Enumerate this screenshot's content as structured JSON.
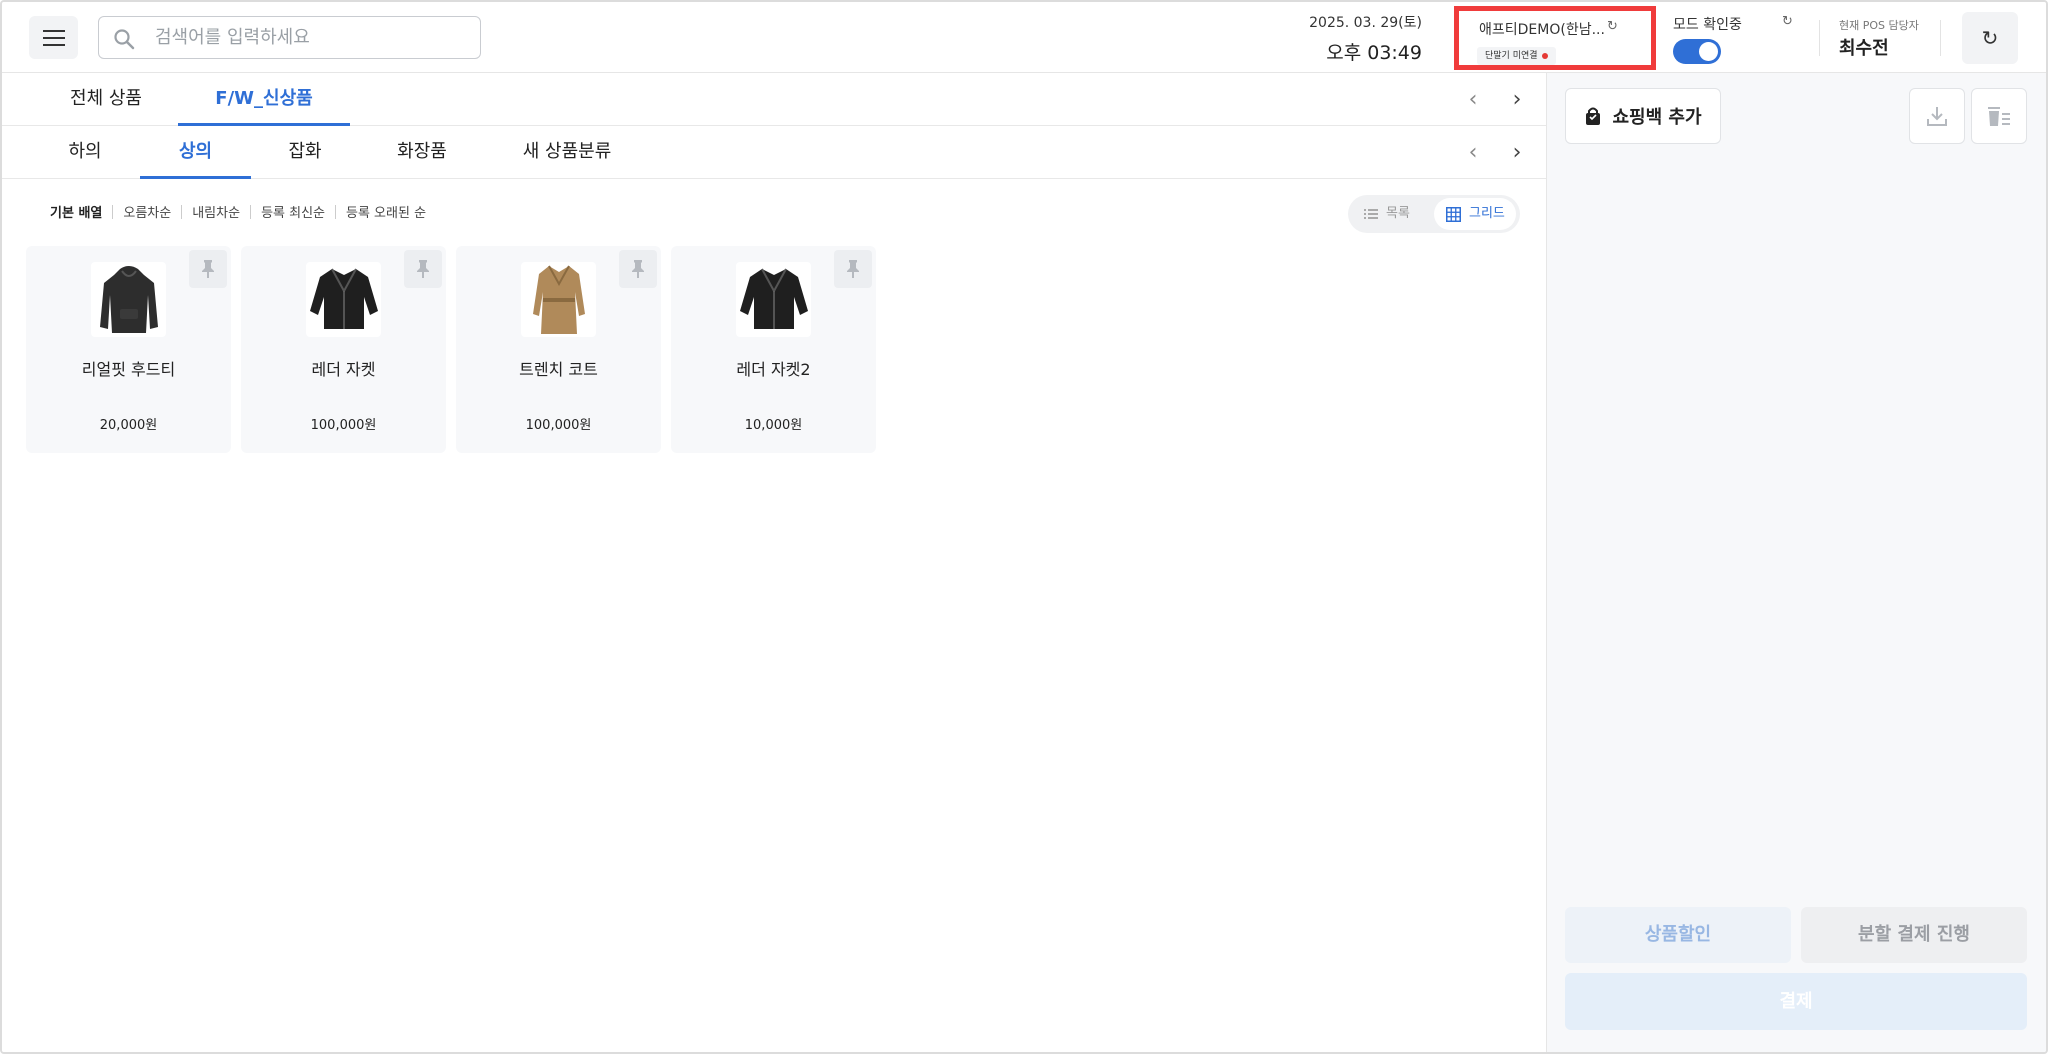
{
  "header": {
    "search_placeholder": "검색어를 입력하세요",
    "date": "2025. 03. 29(토)",
    "time": "오후 03:49",
    "store_name": "애프티DEMO(한남...",
    "device_status": "단말기 미연결",
    "mode_label": "모드 확인중",
    "pos_manager_label": "현재 POS 담당자",
    "pos_manager_name": "최수전"
  },
  "category_tabs": [
    {
      "label": "전체 상품",
      "active": false
    },
    {
      "label": "F/W_신상품",
      "active": true
    }
  ],
  "subcategory_tabs": [
    {
      "label": "하의",
      "active": false
    },
    {
      "label": "상의",
      "active": true
    },
    {
      "label": "잡화",
      "active": false
    },
    {
      "label": "화장품",
      "active": false
    },
    {
      "label": "새 상품분류",
      "active": false
    }
  ],
  "sort_options": [
    "기본 배열",
    "오름차순",
    "내림차순",
    "등록 최신순",
    "등록 오래된 순"
  ],
  "view": {
    "list_label": "목록",
    "grid_label": "그리드",
    "selected": "grid"
  },
  "products": [
    {
      "name": "리얼핏 후드티",
      "price": "20,000원",
      "icon": "hoodie"
    },
    {
      "name": "레더 자켓",
      "price": "100,000원",
      "icon": "leather-jacket"
    },
    {
      "name": "트렌치 코트",
      "price": "100,000원",
      "icon": "trench-coat"
    },
    {
      "name": "레더 자켓2",
      "price": "10,000원",
      "icon": "leather-jacket"
    }
  ],
  "cart": {
    "shopping_bag_label": "쇼핑백 추가",
    "discount_label": "상품할인",
    "split_payment_label": "분할 결제 진행",
    "pay_label": "결제"
  },
  "colors": {
    "accent": "#2f6fd6",
    "highlight_box": "#f03b3b",
    "status_dot": "#e53935"
  }
}
